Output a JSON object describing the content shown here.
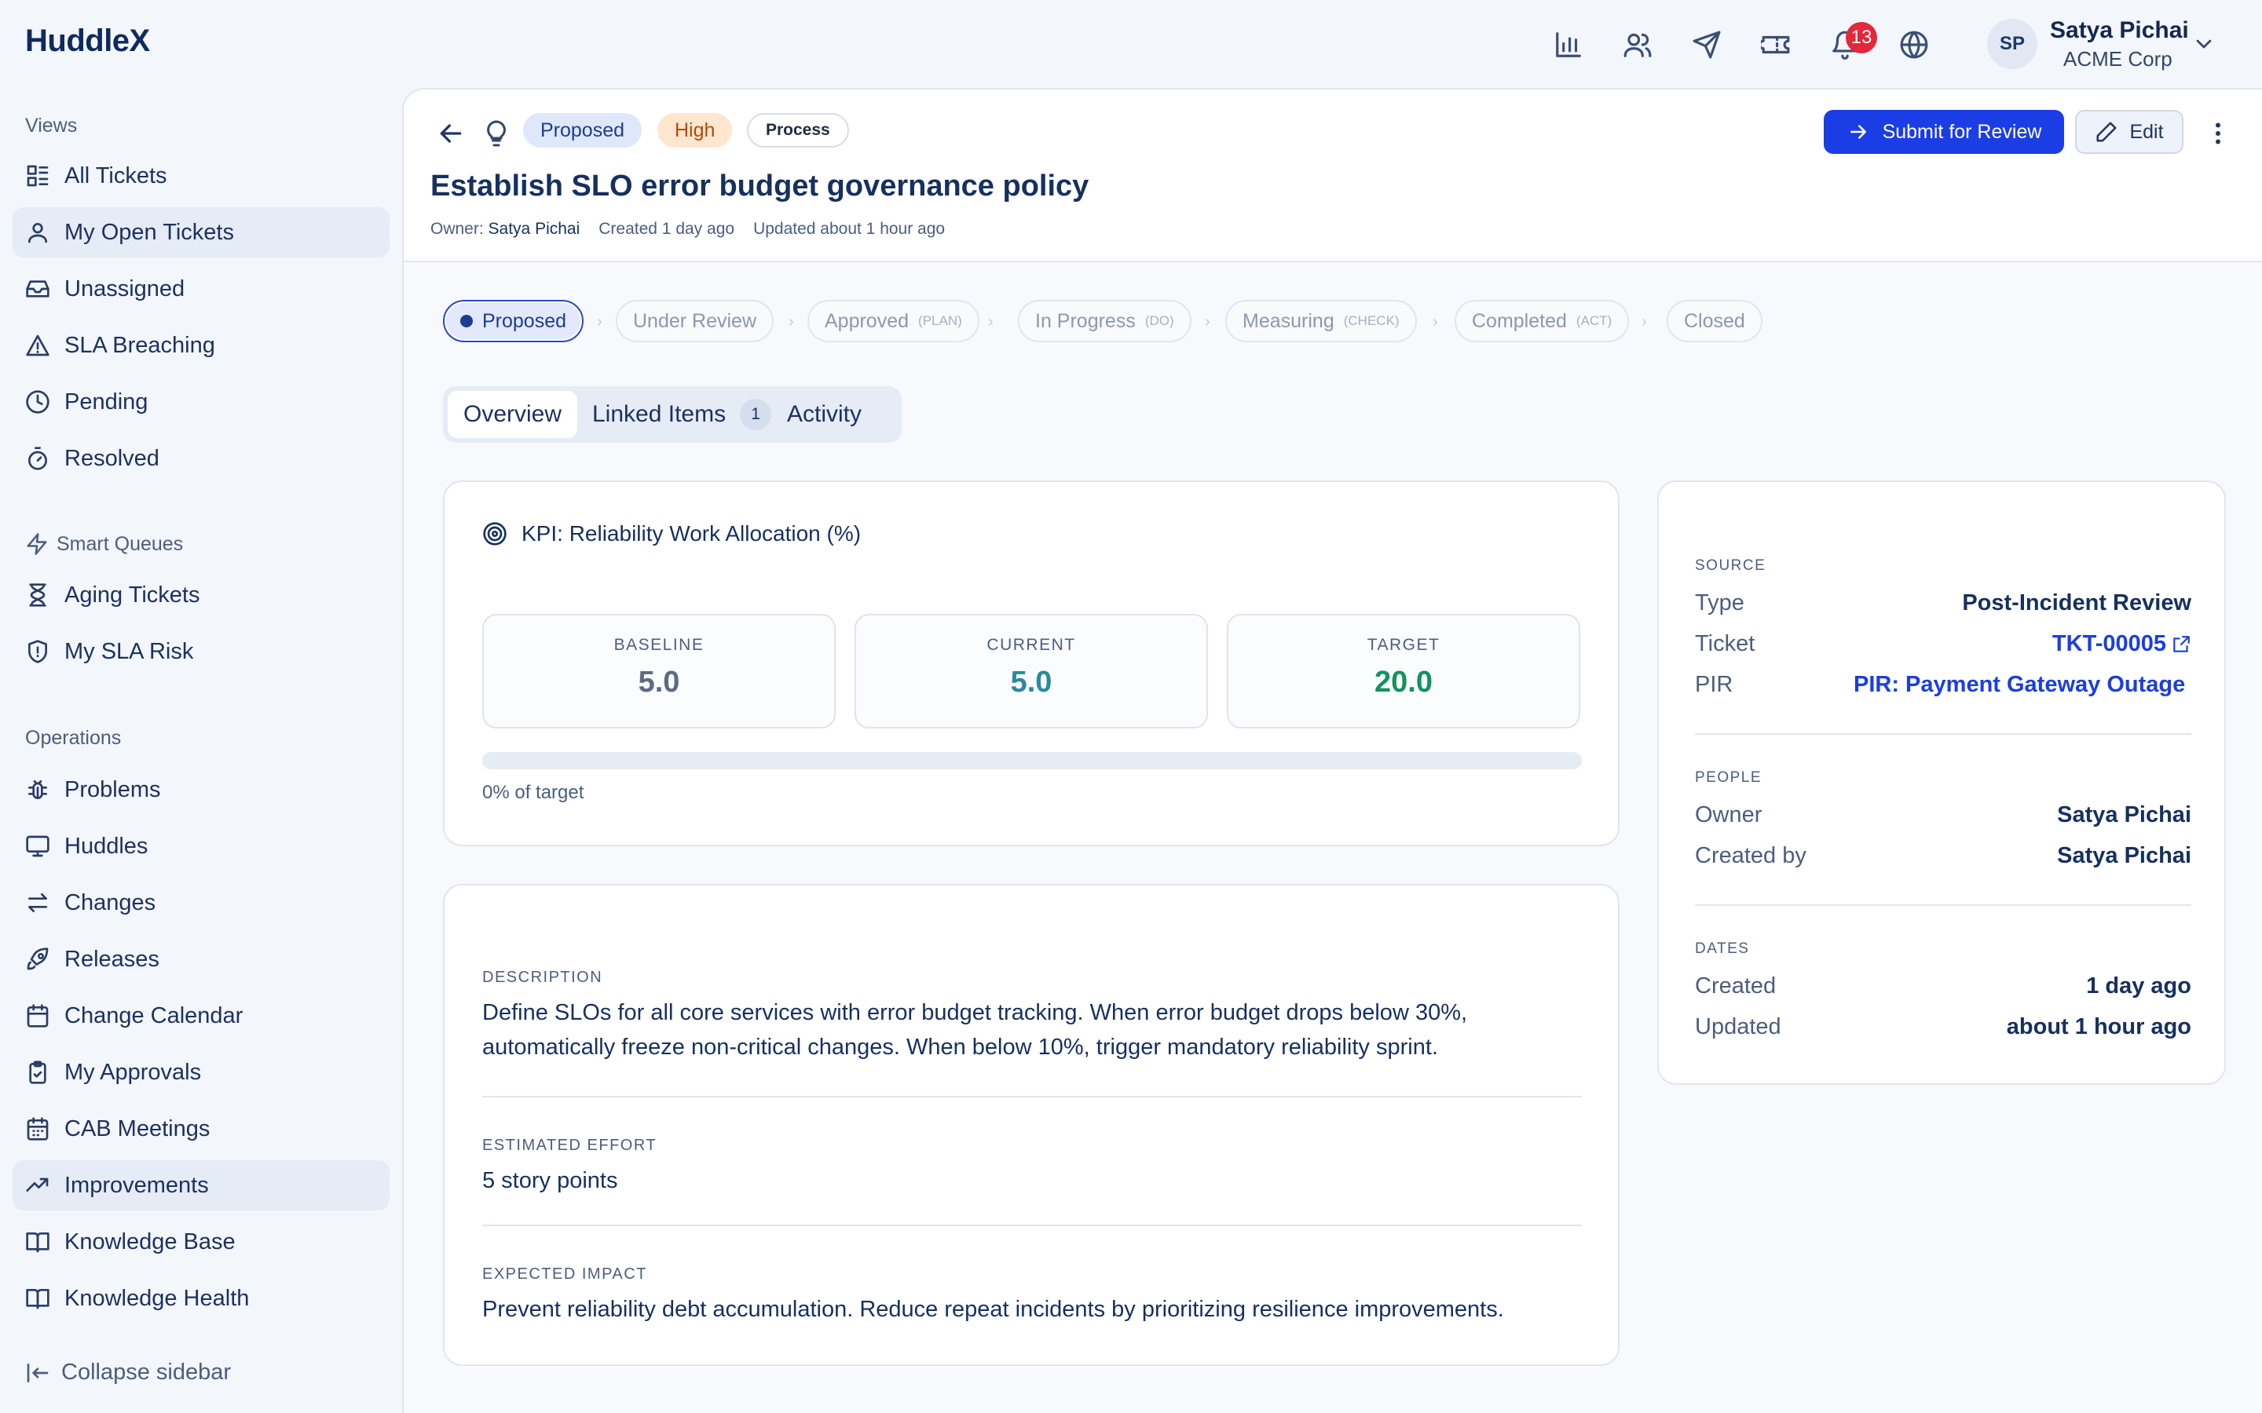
{
  "app": {
    "name": "HuddleX"
  },
  "topbar": {
    "icons": [
      "bar-chart-icon",
      "users-icon",
      "send-icon",
      "ticket-icon",
      "bell-icon",
      "globe-icon"
    ],
    "notification_count": "13",
    "user": {
      "initials": "SP",
      "name": "Satya Pichai",
      "org": "ACME Corp"
    }
  },
  "sidebar": {
    "views_heading": "Views",
    "views": [
      {
        "label": "All Tickets",
        "icon": "list-icon"
      },
      {
        "label": "My Open Tickets",
        "icon": "user-icon",
        "active": true
      },
      {
        "label": "Unassigned",
        "icon": "inbox-icon"
      },
      {
        "label": "SLA Breaching",
        "icon": "alert-triangle-icon"
      },
      {
        "label": "Pending",
        "icon": "clock-icon"
      },
      {
        "label": "Resolved",
        "icon": "timer-icon"
      }
    ],
    "smart_heading": "Smart Queues",
    "smart": [
      {
        "label": "Aging Tickets",
        "icon": "hourglass-icon"
      },
      {
        "label": "My SLA Risk",
        "icon": "shield-alert-icon"
      }
    ],
    "ops_heading": "Operations",
    "ops": [
      {
        "label": "Problems",
        "icon": "bug-icon"
      },
      {
        "label": "Huddles",
        "icon": "monitor-icon"
      },
      {
        "label": "Changes",
        "icon": "swap-icon"
      },
      {
        "label": "Releases",
        "icon": "rocket-icon"
      },
      {
        "label": "Change Calendar",
        "icon": "calendar-icon"
      },
      {
        "label": "My Approvals",
        "icon": "clipboard-check-icon"
      },
      {
        "label": "CAB Meetings",
        "icon": "calendar-grid-icon"
      },
      {
        "label": "Improvements",
        "icon": "trending-up-icon",
        "active": true
      },
      {
        "label": "Knowledge Base",
        "icon": "book-open-icon"
      },
      {
        "label": "Knowledge Health",
        "icon": "book-icon"
      }
    ],
    "collapse_label": "Collapse sidebar"
  },
  "header": {
    "status": "Proposed",
    "priority": "High",
    "type": "Process",
    "title": "Establish SLO error budget governance policy",
    "owner_label": "Owner:",
    "owner_name": "Satya Pichai",
    "created": "Created 1 day ago",
    "updated": "Updated about 1 hour ago",
    "submit_label": "Submit for Review",
    "edit_label": "Edit"
  },
  "stepper": [
    {
      "label": "Proposed",
      "tag": "",
      "current": true
    },
    {
      "label": "Under Review",
      "tag": ""
    },
    {
      "label": "Approved",
      "tag": "(PLAN)"
    },
    {
      "label": "In Progress",
      "tag": "(DO)"
    },
    {
      "label": "Measuring",
      "tag": "(CHECK)"
    },
    {
      "label": "Completed",
      "tag": "(ACT)"
    },
    {
      "label": "Closed",
      "tag": ""
    }
  ],
  "tabs": [
    {
      "label": "Overview",
      "active": true
    },
    {
      "label": "Linked Items",
      "count": "1"
    },
    {
      "label": "Activity"
    }
  ],
  "kpi": {
    "title": "KPI: Reliability Work Allocation (%)",
    "baseline_label": "BASELINE",
    "baseline": "5.0",
    "current_label": "CURRENT",
    "current": "5.0",
    "target_label": "TARGET",
    "target": "20.0",
    "progress_fraction": 0,
    "progress_label": "0% of target",
    "colors": {
      "baseline": "#5d6b82",
      "current": "#2b8a9c",
      "target": "#13925f"
    }
  },
  "details": {
    "description_label": "DESCRIPTION",
    "description": "Define SLOs for all core services with error budget tracking. When error budget drops below 30%, automatically freeze non-critical changes. When below 10%, trigger mandatory reliability sprint.",
    "effort_label": "ESTIMATED EFFORT",
    "effort": "5 story points",
    "impact_label": "EXPECTED IMPACT",
    "impact": "Prevent reliability debt accumulation. Reduce repeat incidents by prioritizing resilience improvements."
  },
  "info": {
    "source_label": "SOURCE",
    "type_key": "Type",
    "type_val": "Post-Incident Review",
    "ticket_key": "Ticket",
    "ticket_val": "TKT-00005",
    "pir_key": "PIR",
    "pir_val": "PIR: Payment Gateway Outage",
    "people_label": "PEOPLE",
    "owner_key": "Owner",
    "owner_val": "Satya Pichai",
    "created_by_key": "Created by",
    "created_by_val": "Satya Pichai",
    "dates_label": "DATES",
    "created_key": "Created",
    "created_val": "1 day ago",
    "updated_key": "Updated",
    "updated_val": "about 1 hour ago"
  }
}
